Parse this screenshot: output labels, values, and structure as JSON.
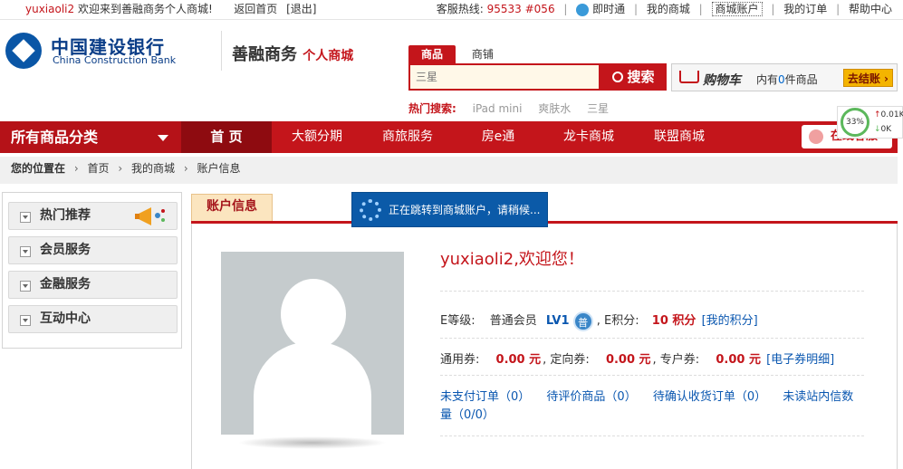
{
  "topbar": {
    "username": "yuxiaoli2",
    "welcome_text": "欢迎来到善融商务个人商城!",
    "home_link": "返回首页",
    "logout_link": "[退出]",
    "hotline_label": "客服热线:",
    "hotline_number": "95533 #056",
    "im_link": "即时通",
    "my_mall_link": "我的商城",
    "mall_account_link": "商城账户",
    "my_orders_link": "我的订单",
    "help_link": "帮助中心"
  },
  "logo": {
    "bank_cn": "中国建设银行",
    "bank_en": "China Construction Bank",
    "shop_name": "善融商务",
    "shop_sub": "个人商城"
  },
  "search": {
    "tab_goods": "商品",
    "tab_shop": "商铺",
    "placeholder": "三星",
    "button": "搜索",
    "hot_label": "热门搜索:",
    "hot_words": [
      "iPad mini",
      "爽肤水",
      "三星"
    ]
  },
  "cart": {
    "title": "购物车",
    "count_prefix": "内有",
    "count": "0",
    "count_suffix": "件商品",
    "checkout": "去结账 ›"
  },
  "floater": {
    "percent": "33%",
    "up": "0.01K",
    "down": "0K"
  },
  "nav": {
    "all_categories": "所有商品分类",
    "items": [
      "首 页",
      "大额分期",
      "商旅服务",
      "房e通",
      "龙卡商城",
      "联盟商城"
    ],
    "online_service": "在线客服"
  },
  "breadcrumb": {
    "label": "您的位置在",
    "items": [
      "首页",
      "我的商城",
      "账户信息"
    ]
  },
  "sidebar": {
    "items": [
      "热门推荐",
      "会员服务",
      "金融服务",
      "互动中心"
    ]
  },
  "account": {
    "tab_label": "账户信息",
    "redirect_text": "正在跳转到商城账户，请稍候...",
    "welcome": "yuxiaoli2,欢迎您！",
    "level_label": "E等级:",
    "member_type": "普通会员",
    "level": "LV1",
    "level_badge": "普",
    "points_label": ", E积分:",
    "points": "10 积分",
    "points_link": "[我的积分]",
    "general_coupon_label": "通用券:",
    "general_coupon": "0.00 元",
    "targeted_coupon_label": ", 定向券:",
    "targeted_coupon": "0.00 元",
    "exclusive_coupon_label": ", 专户券:",
    "exclusive_coupon": "0.00 元",
    "coupon_link": "[电子券明细]",
    "unpaid": "未支付订单（0）",
    "to_review": "待评价商品（0）",
    "to_confirm": "待确认收货订单（0）",
    "unread": "未读站内信数量（0/0）"
  }
}
